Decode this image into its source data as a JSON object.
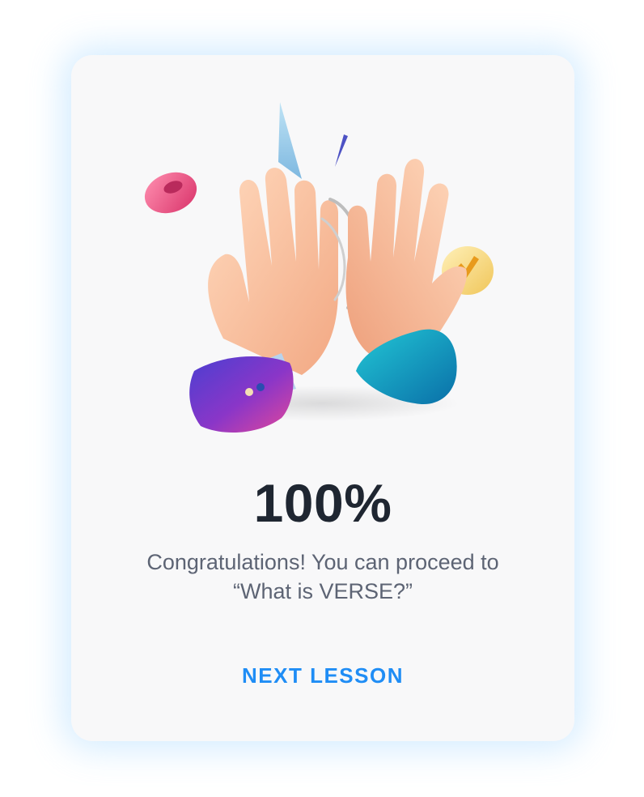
{
  "result": {
    "score": "100%",
    "message_line1": "Congratulations! You can proceed to",
    "message_line2": "“What is VERSE?”"
  },
  "actions": {
    "next_lesson_label": "NEXT LESSON"
  },
  "colors": {
    "accent": "#1f8df5",
    "score_text": "#1f2631",
    "message_text": "#5d6474",
    "card_background": "#f8f8f9",
    "glow": "#a0d4ff"
  },
  "illustration": {
    "icon": "high-five-hands-illustration"
  }
}
